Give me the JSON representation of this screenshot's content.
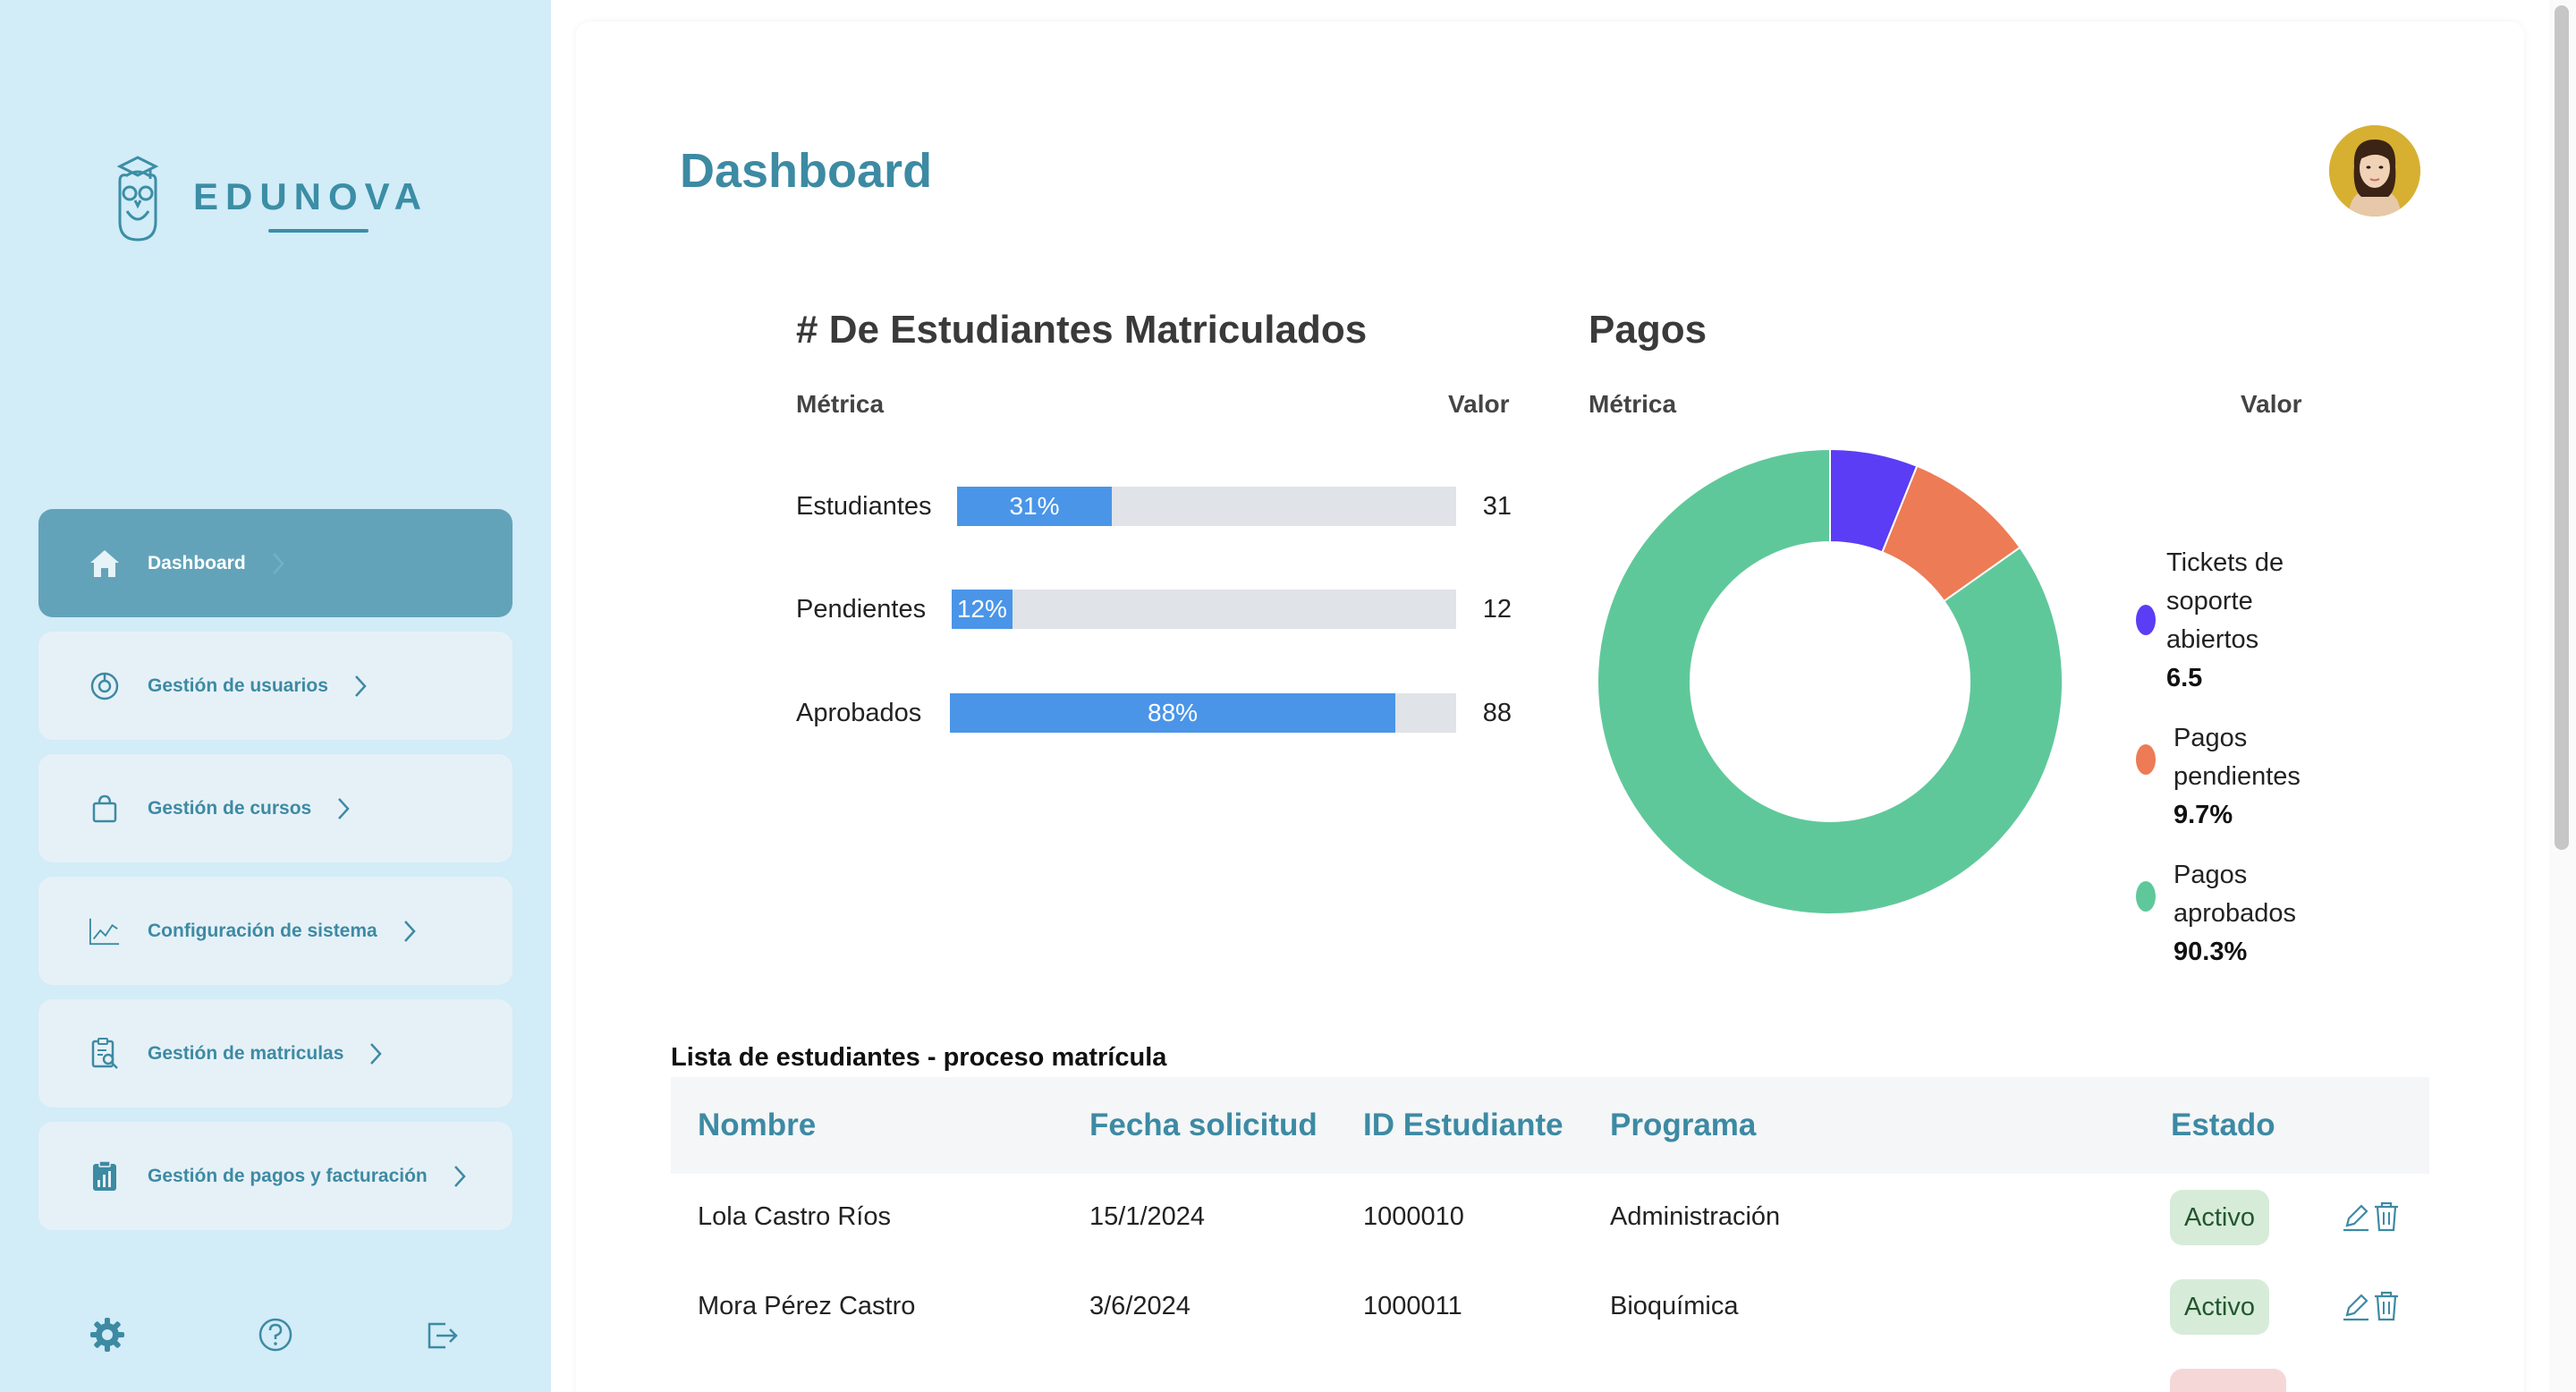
{
  "brand": {
    "name": "EDUNOVA"
  },
  "sidebar": {
    "items": [
      {
        "label": "Dashboard",
        "icon": "home-icon",
        "active": true
      },
      {
        "label": "Gestión de usuarios",
        "icon": "user-circle-icon"
      },
      {
        "label": "Gestión de cursos",
        "icon": "bag-icon"
      },
      {
        "label": "Configuración de sistema",
        "icon": "chart-line-icon"
      },
      {
        "label": "Gestión de matriculas",
        "icon": "clipboard-search-icon"
      },
      {
        "label": "Gestión de pagos y facturación",
        "icon": "clipboard-chart-icon"
      }
    ],
    "bottom_icons": [
      "gear-icon",
      "help-icon",
      "logout-icon"
    ]
  },
  "header": {
    "title": "Dashboard"
  },
  "students_chart": {
    "title": "# De Estudiantes Matriculados",
    "col_metric": "Métrica",
    "col_value": "Valor",
    "rows": [
      {
        "label": "Estudiantes",
        "percent_label": "31%",
        "value": "31",
        "fraction": 0.31
      },
      {
        "label": "Pendientes",
        "percent_label": "12%",
        "value": "12",
        "fraction": 0.12
      },
      {
        "label": "Aprobados",
        "percent_label": "88%",
        "value": "88",
        "fraction": 0.88
      }
    ]
  },
  "payments_chart": {
    "title": "Pagos",
    "col_metric": "Métrica",
    "col_value": "Valor",
    "legend": [
      {
        "label": "Tickets de soporte abiertos",
        "value": "6.5"
      },
      {
        "label": "Pagos pendientes",
        "value": "9.7%"
      },
      {
        "label": "Pagos aprobados",
        "value": "90.3%"
      }
    ]
  },
  "chart_data": [
    {
      "type": "bar",
      "title": "# De Estudiantes Matriculados",
      "categories": [
        "Estudiantes",
        "Pendientes",
        "Aprobados"
      ],
      "values": [
        31,
        12,
        88
      ],
      "ylim": [
        0,
        100
      ]
    },
    {
      "type": "pie",
      "title": "Pagos",
      "categories": [
        "Tickets de soporte abiertos",
        "Pagos pendientes",
        "Pagos aprobados"
      ],
      "values": [
        6.5,
        9.7,
        90.3
      ],
      "colors": [
        "#5b3df5",
        "#ed7b55",
        "#5fc89a"
      ],
      "legend": "right"
    }
  ],
  "table": {
    "title": "Lista de estudiantes - proceso matrícula",
    "headers": [
      "Nombre",
      "Fecha solicitud",
      "ID Estudiante",
      "Programa",
      "Estado"
    ],
    "rows": [
      {
        "nombre": "Lola Castro Ríos",
        "fecha": "15/1/2024",
        "id": "1000010",
        "programa": "Administración",
        "estado": "Activo"
      },
      {
        "nombre": "Mora Pérez Castro",
        "fecha": "3/6/2024",
        "id": "1000011",
        "programa": "Bioquímica",
        "estado": "Activo"
      }
    ]
  },
  "colors": {
    "accent": "#3d8aa3",
    "sidebar_bg": "#d2ecf8",
    "active_nav": "#63a3b9",
    "bar_fill": "#4a95e8",
    "bar_track": "#e0e3e8"
  }
}
